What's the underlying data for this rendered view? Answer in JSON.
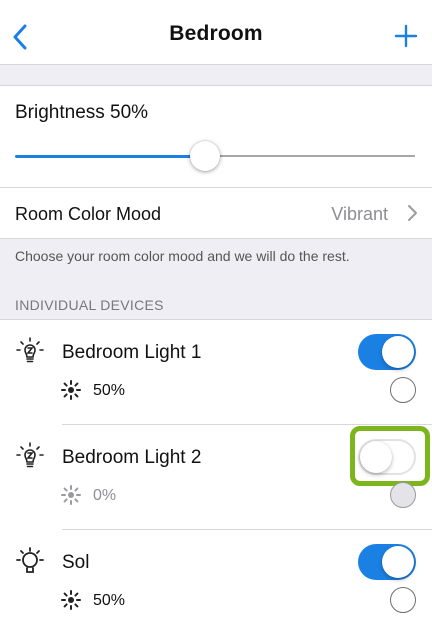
{
  "nav": {
    "title": "Bedroom",
    "back_icon": "chevron-left-icon",
    "add_icon": "plus-icon",
    "accent_color": "#1b80e4"
  },
  "brightness": {
    "label": "Brightness 50%",
    "value_percent": 50
  },
  "room_color_mood": {
    "label": "Room Color Mood",
    "value": "Vibrant",
    "description": "Choose your room color mood and we will do the rest."
  },
  "section_header": "INDIVIDUAL DEVICES",
  "devices": [
    {
      "name": "Bedroom Light 1",
      "on": true,
      "brightness": "50%",
      "icon": "bulb-icon"
    },
    {
      "name": "Bedroom Light 2",
      "on": false,
      "brightness": "0%",
      "icon": "bulb-icon"
    },
    {
      "name": "Sol",
      "on": true,
      "brightness": "50%",
      "icon": "sol-lamp-icon"
    }
  ],
  "colors": {
    "toggle_on": "#1b80e4",
    "highlight": "#7db51d",
    "group_background": "#efeef4"
  }
}
